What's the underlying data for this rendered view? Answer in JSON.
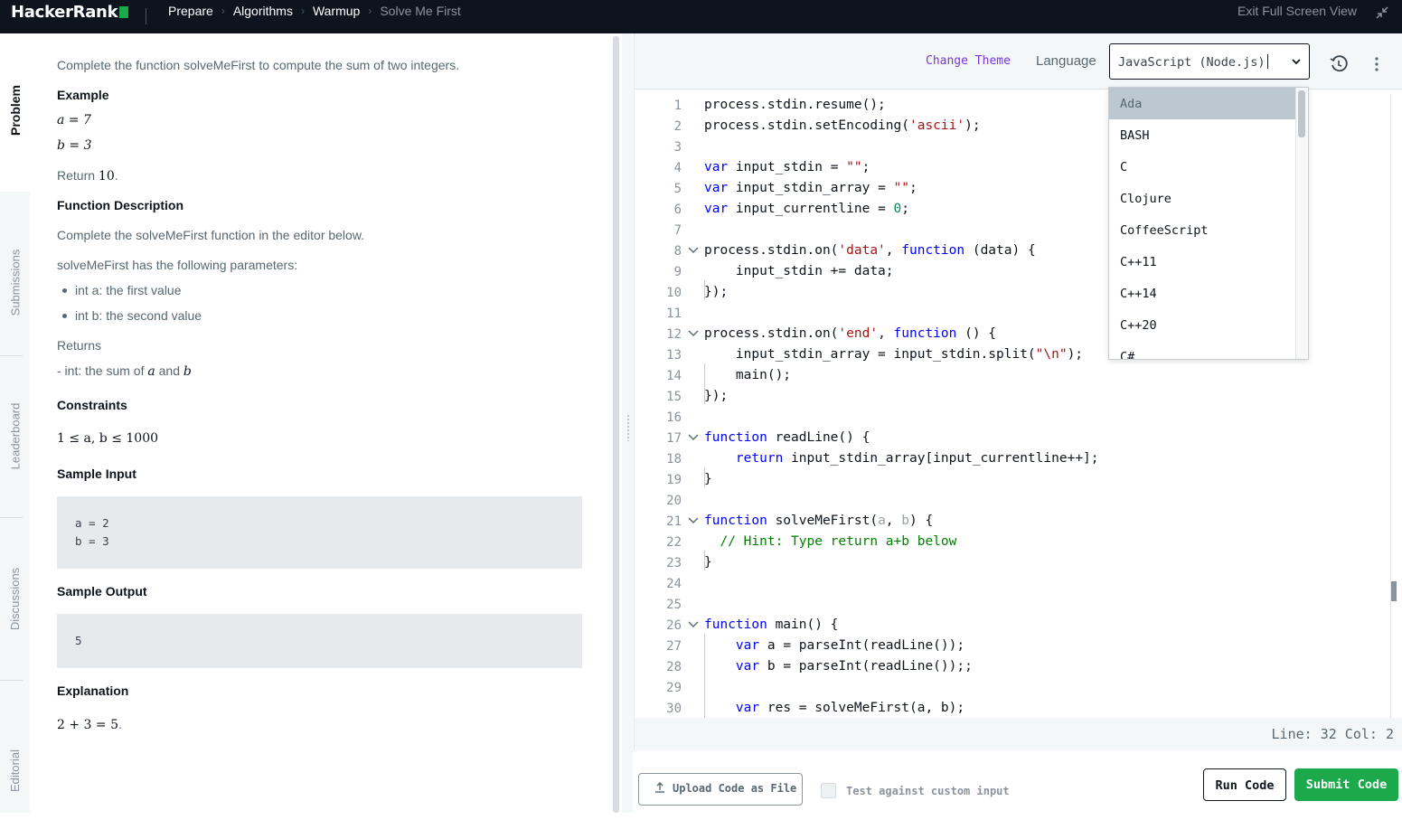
{
  "header": {
    "logo_text": "HackerRank",
    "breadcrumbs": [
      "Prepare",
      "Algorithms",
      "Warmup",
      "Solve Me First"
    ],
    "exit_label": "Exit Full Screen View"
  },
  "tabs": [
    "Problem",
    "Submissions",
    "Leaderboard",
    "Discussions",
    "Editorial"
  ],
  "problem": {
    "intro": "Complete the function solveMeFirst to compute the sum of two integers.",
    "example_heading": "Example",
    "ex_a": "a = 7",
    "ex_b": "b = 3",
    "return_prefix": "Return ",
    "return_value": "10",
    "return_suffix": ".",
    "func_desc_heading": "Function Description",
    "func_desc_text": "Complete the solveMeFirst function in the editor below.",
    "params_intro": "solveMeFirst has the following parameters:",
    "params": [
      "int a: the first value",
      "int b: the second value"
    ],
    "returns_heading": "Returns",
    "returns_prefix": "- int: the sum of ",
    "returns_a": "a",
    "returns_and": " and ",
    "returns_b": "b",
    "constraints_heading": "Constraints",
    "constraint": "1 ≤ a, b ≤ 1000",
    "sample_input_heading": "Sample Input",
    "sample_input": [
      "a = 2",
      "b = 3"
    ],
    "sample_output_heading": "Sample Output",
    "sample_output": "5",
    "explanation_heading": "Explanation",
    "explanation": "2 + 3 = 5",
    "explanation_suffix": "."
  },
  "editor": {
    "change_theme": "Change Theme",
    "language_label": "Language",
    "language_value": "JavaScript (Node.js)",
    "status": "Line: 32 Col: 2",
    "lines": [
      {
        "n": "1",
        "fold": false,
        "html": "process.stdin.resume();"
      },
      {
        "n": "2",
        "fold": false,
        "html": "process.stdin.setEncoding(<s>'ascii'</s>);"
      },
      {
        "n": "3",
        "fold": false,
        "html": ""
      },
      {
        "n": "4",
        "fold": false,
        "html": "<k>var</k> input_stdin = <s>\"\"</s>;"
      },
      {
        "n": "5",
        "fold": false,
        "html": "<k>var</k> input_stdin_array = <s>\"\"</s>;"
      },
      {
        "n": "6",
        "fold": false,
        "html": "<k>var</k> input_currentline = <n>0</n>;"
      },
      {
        "n": "7",
        "fold": false,
        "html": ""
      },
      {
        "n": "8",
        "fold": true,
        "html": "process.stdin.on(<s>'data'</s>, <k>function</k> (data) {"
      },
      {
        "n": "9",
        "fold": false,
        "html": "    input_stdin += data;"
      },
      {
        "n": "10",
        "fold": false,
        "html": "});"
      },
      {
        "n": "11",
        "fold": false,
        "html": ""
      },
      {
        "n": "12",
        "fold": true,
        "html": "process.stdin.on(<s>'end'</s>, <k>function</k> () {"
      },
      {
        "n": "13",
        "fold": false,
        "html": "    input_stdin_array = input_stdin.split(<s>\"\\n\"</s>);"
      },
      {
        "n": "14",
        "fold": false,
        "html": "    main();"
      },
      {
        "n": "15",
        "fold": false,
        "html": "});"
      },
      {
        "n": "16",
        "fold": false,
        "html": ""
      },
      {
        "n": "17",
        "fold": true,
        "html": "<k>function</k> readLine() {"
      },
      {
        "n": "18",
        "fold": false,
        "html": "    <k>return</k> input_stdin_array[input_currentline++];"
      },
      {
        "n": "19",
        "fold": false,
        "html": "}"
      },
      {
        "n": "20",
        "fold": false,
        "html": ""
      },
      {
        "n": "21",
        "fold": true,
        "html": "<k>function</k> solveMeFirst(<p>a</p>, <p>b</p>) {"
      },
      {
        "n": "22",
        "fold": false,
        "html": "  <c>// Hint: Type return a+b below</c>"
      },
      {
        "n": "23",
        "fold": false,
        "html": "}"
      },
      {
        "n": "24",
        "fold": false,
        "html": ""
      },
      {
        "n": "25",
        "fold": false,
        "html": ""
      },
      {
        "n": "26",
        "fold": true,
        "html": "<k>function</k> main() {"
      },
      {
        "n": "27",
        "fold": false,
        "html": "    <k>var</k> a = parseInt(readLine());"
      },
      {
        "n": "28",
        "fold": false,
        "html": "    <k>var</k> b = parseInt(readLine());;"
      },
      {
        "n": "29",
        "fold": false,
        "html": ""
      },
      {
        "n": "30",
        "fold": false,
        "html": "    <k>var</k> res = solveMeFirst(a, b);"
      }
    ]
  },
  "language_options": [
    "Ada",
    "BASH",
    "C",
    "Clojure",
    "CoffeeScript",
    "C++11",
    "C++14",
    "C++20",
    "C#"
  ],
  "actions": {
    "upload": "Upload Code as File",
    "custom_input": "Test against custom input",
    "run": "Run Code",
    "submit": "Submit Code"
  },
  "colors": {
    "topbar": "#0e141e",
    "brand_green": "#1ba94c",
    "keyword": "#0000ff",
    "string": "#a31515",
    "number": "#09885a",
    "comment": "#008000",
    "theme_link": "#7b36dc"
  }
}
